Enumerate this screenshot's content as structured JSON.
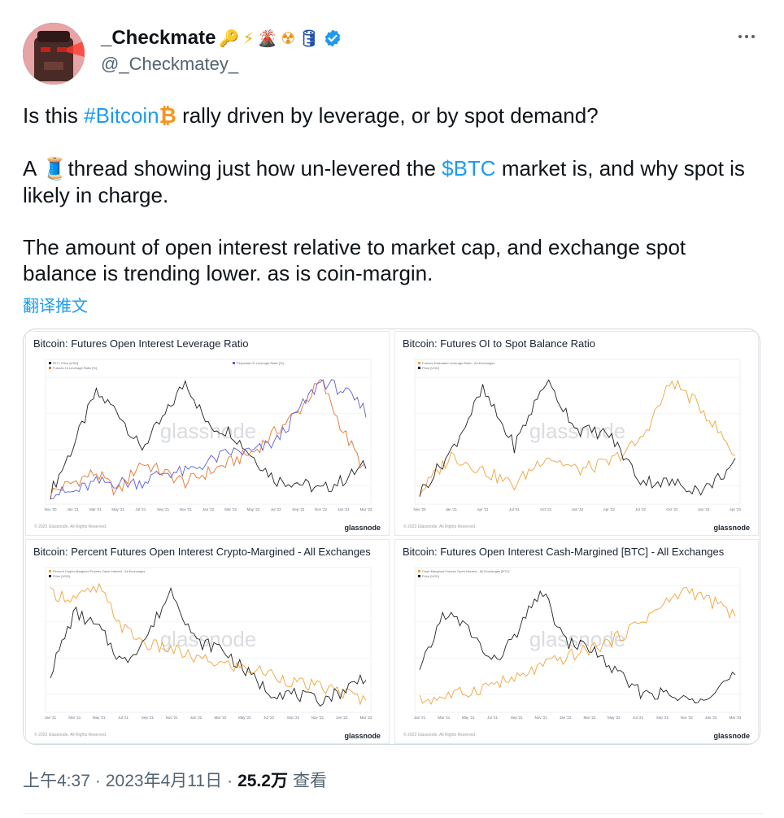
{
  "author": {
    "display_name": "_Checkmate",
    "handle": "@_Checkmatey_",
    "emojis": [
      "🔑",
      "⚡",
      "🌋",
      "☢",
      "🛢"
    ],
    "verified": true
  },
  "colors": {
    "link": "#1d9bf0",
    "muted": "#536471",
    "text": "#0f1419",
    "orange": "#e8742b",
    "gold": "#f2a33a",
    "blue": "#5b5fd6",
    "black": "#222222"
  },
  "tweet": {
    "p1_before": "Is this ",
    "hashtag": "#Bitcoin",
    "bitcoin_emoji": "₿",
    "p1_after": " rally driven by leverage, or by spot demand?",
    "p2_before": "A ",
    "thread_emoji": "🧵",
    "p2_middle": "thread showing just how un-levered the ",
    "cashtag": "$BTC",
    "p2_after": " market is, and why spot is likely in charge.",
    "p3": "The amount of open interest relative to market cap, and exchange spot balance is trending lower. as is coin-margin."
  },
  "translate_label": "翻译推文",
  "charts": {
    "watermark": "glassnode",
    "logo": "glassnode",
    "copyright": "© 2023 Glassnode. All Rights Reserved.",
    "titles": [
      "Bitcoin: Futures Open Interest Leverage Ratio",
      "Bitcoin: Futures OI to Spot Balance Ratio",
      "Bitcoin: Percent Futures Open Interest Crypto-Margined - All Exchanges",
      "Bitcoin: Futures Open Interest Cash-Margined [BTC] - All Exchanges"
    ]
  },
  "chart_data": [
    {
      "type": "line",
      "title": "Bitcoin: Futures Open Interest Leverage Ratio",
      "x": [
        "Nov '20",
        "Jan '21",
        "Mar '21",
        "May '21",
        "Jul '21",
        "Sep '21",
        "Nov '21",
        "Jan '22",
        "Mar '22",
        "May '22",
        "Jul '22",
        "Sep '22",
        "Nov '22",
        "Jan '23",
        "Mar '23"
      ],
      "series": [
        {
          "name": "BTC: Price [USD]",
          "color": "#222222",
          "values": [
            16,
            34,
            55,
            48,
            33,
            45,
            60,
            42,
            40,
            30,
            21,
            20,
            17,
            21,
            27
          ]
        },
        {
          "name": "Futures OI Leverage Ratio [%]",
          "color": "#e8742b",
          "values": [
            1.8,
            1.9,
            2.0,
            1.8,
            2.1,
            2.0,
            1.9,
            2.0,
            2.1,
            2.2,
            2.4,
            2.6,
            2.9,
            2.4,
            2.0
          ]
        },
        {
          "name": "Perpetual OI Leverage Ratio [%]",
          "color": "#5b5fd6",
          "values": [
            0.8,
            0.8,
            0.9,
            0.9,
            0.9,
            1.0,
            1.0,
            1.1,
            1.2,
            1.2,
            1.3,
            1.6,
            1.9,
            1.8,
            1.6
          ]
        }
      ]
    },
    {
      "type": "line",
      "title": "Bitcoin: Futures OI to Spot Balance Ratio",
      "x": [
        "Nov '20",
        "Jan '21",
        "Apr '21",
        "Jul '21",
        "Oct '21",
        "Jan '22",
        "Apr '22",
        "Jul '22",
        "Oct '22",
        "Jan '23",
        "Apr '23"
      ],
      "series": [
        {
          "name": "Futures Estimated Leverage Ratio - All Exchanges",
          "color": "#f2a33a",
          "values": [
            0.13,
            0.18,
            0.16,
            0.14,
            0.18,
            0.16,
            0.17,
            0.2,
            0.28,
            0.24,
            0.18
          ]
        },
        {
          "name": "Price [USD]",
          "color": "#222222",
          "values": [
            16,
            33,
            58,
            35,
            62,
            42,
            40,
            21,
            20,
            17,
            28
          ]
        }
      ]
    },
    {
      "type": "line",
      "title": "Bitcoin: Percent Futures Open Interest Crypto-Margined - All Exchanges",
      "x": [
        "Jan '21",
        "Mar '21",
        "May '21",
        "Jul '21",
        "Sep '21",
        "Nov '21",
        "Jan '22",
        "Mar '22",
        "May '22",
        "Jul '22",
        "Sep '22",
        "Nov '22",
        "Jan '23",
        "Mar '23"
      ],
      "series": [
        {
          "name": "Percent Crypto-Margined Futures Open Interest - All Exchanges",
          "color": "#f2a33a",
          "values": [
            70,
            68,
            72,
            55,
            48,
            46,
            42,
            40,
            38,
            36,
            32,
            30,
            28,
            24
          ]
        },
        {
          "name": "Price [USD]",
          "color": "#222222",
          "values": [
            29,
            55,
            48,
            33,
            45,
            65,
            42,
            40,
            30,
            21,
            20,
            17,
            21,
            28
          ]
        }
      ]
    },
    {
      "type": "line",
      "title": "Bitcoin: Futures Open Interest Cash-Margined [BTC] - All Exchanges",
      "x": [
        "Jan '21",
        "Mar '21",
        "May '21",
        "Jul '21",
        "Sep '21",
        "Nov '21",
        "Jan '22",
        "Mar '22",
        "May '22",
        "Jul '22",
        "Sep '22",
        "Nov '22",
        "Jan '23",
        "Mar '23"
      ],
      "series": [
        {
          "name": "Cash-Margined Futures Open Interest - All Exchanges [BTC]",
          "color": "#f2a33a",
          "values": [
            120,
            130,
            140,
            160,
            170,
            200,
            220,
            240,
            260,
            300,
            340,
            380,
            350,
            320
          ]
        },
        {
          "name": "Price [USD]",
          "color": "#222222",
          "values": [
            29,
            55,
            48,
            33,
            45,
            65,
            42,
            40,
            30,
            21,
            20,
            17,
            21,
            28
          ]
        }
      ]
    }
  ],
  "meta": {
    "time": "上午4:37",
    "sep1": "·",
    "date": "2023年4月11日",
    "sep2": "·",
    "views": "25.2万",
    "views_label": "查看"
  }
}
